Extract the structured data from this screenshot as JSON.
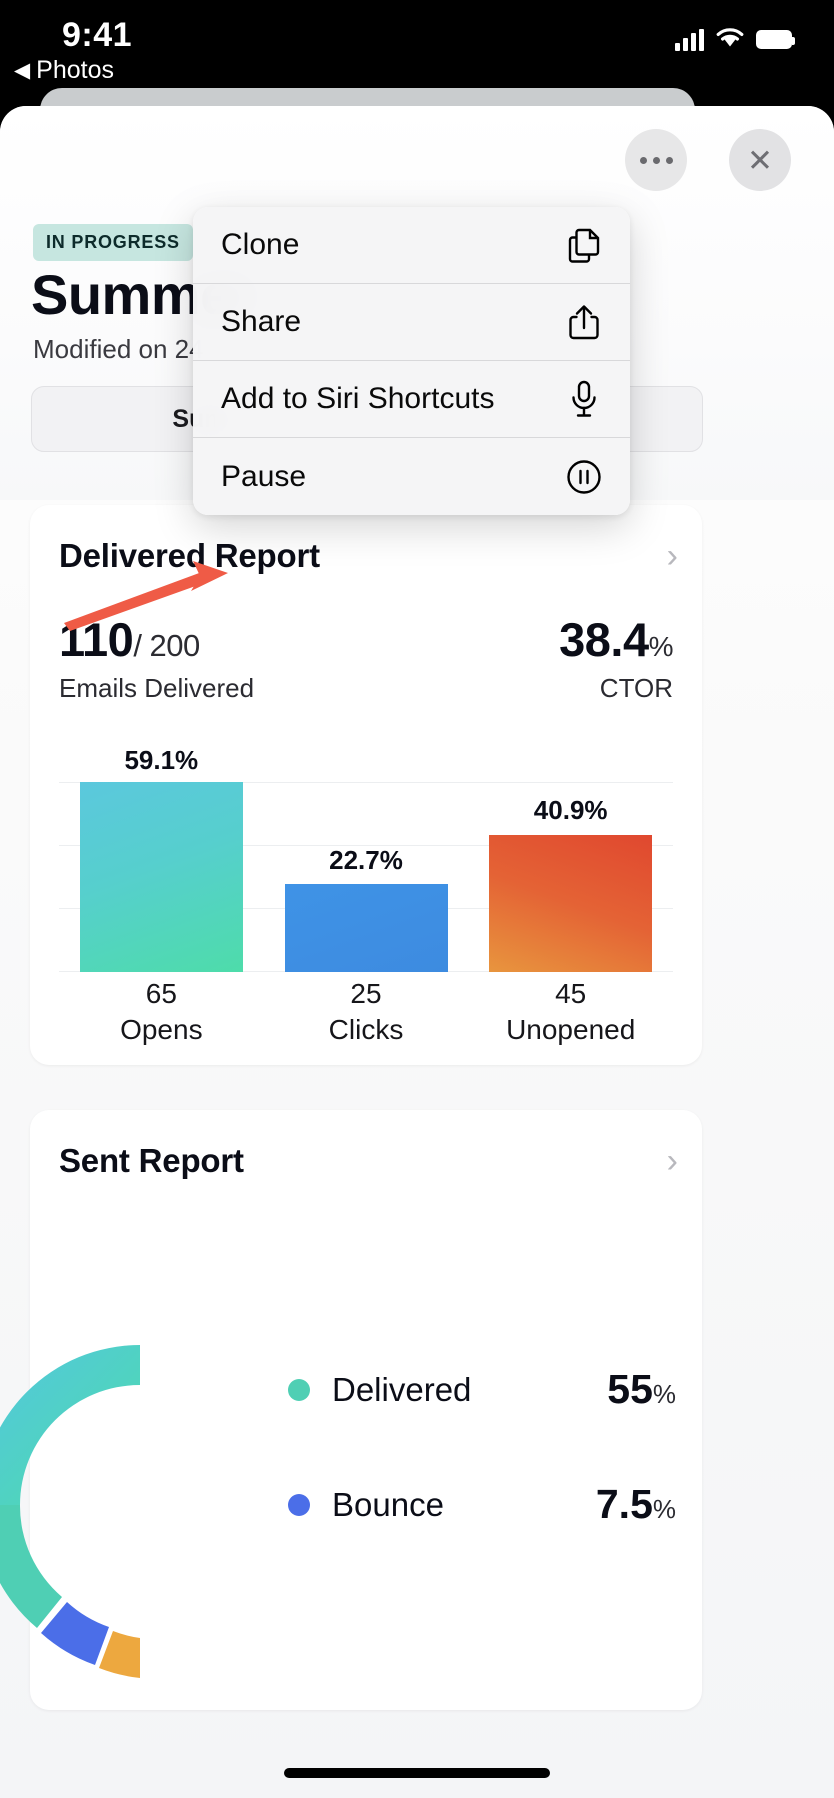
{
  "status_bar": {
    "time": "9:41",
    "back_label": "Photos",
    "back_arrow": "◀",
    "icons": [
      "cellular-signal-icon",
      "wifi-icon",
      "battery-icon"
    ]
  },
  "sheet": {
    "status_badge": "IN PROGRESS",
    "title": "Summer",
    "modified": "Modified on 24",
    "segment_label": "Sum",
    "more_button": "more-options-button",
    "close_button": "✕"
  },
  "context_menu": {
    "items": [
      {
        "label": "Clone",
        "icon": "copy-icon"
      },
      {
        "label": "Share",
        "icon": "share-icon"
      },
      {
        "label": "Add to Siri Shortcuts",
        "icon": "microphone-icon"
      },
      {
        "label": "Pause",
        "icon": "pause-circle-icon"
      }
    ]
  },
  "delivered_card": {
    "title": "Delivered Report",
    "chevron": "›",
    "delivered_count": "110",
    "delivered_total": "/ 200",
    "delivered_label": "Emails Delivered",
    "ctor_value": "38.4",
    "ctor_unit": "%",
    "ctor_label": "CTOR"
  },
  "sent_card": {
    "title": "Sent Report",
    "chevron": "›",
    "legend": [
      {
        "name": "Delivered",
        "value": "55",
        "unit": "%",
        "color": "#4fcfb4"
      },
      {
        "name": "Bounce",
        "value": "7.5",
        "unit": "%",
        "color": "#4b6ee8"
      }
    ]
  },
  "colors": {
    "badge_bg": "#c6e6e0",
    "bar_opens_start": "#5bc8dd",
    "bar_opens_end": "#4edcaa",
    "bar_clicks": "#3d90e3",
    "bar_unopened_start": "#e8903c",
    "bar_unopened_end": "#e0482f",
    "donut_delivered": "#4fcfb4",
    "donut_bounce": "#4b6ee8",
    "donut_other": "#eda83f",
    "arrow": "#ef5b46"
  },
  "chart_data": [
    {
      "type": "bar",
      "title": "Delivered Report",
      "categories": [
        "Opens",
        "Clicks",
        "Unopened"
      ],
      "values": [
        59.1,
        22.7,
        40.9
      ],
      "value_labels": [
        "59.1%",
        "22.7%",
        "40.9%"
      ],
      "counts": [
        65,
        25,
        45
      ],
      "count_labels": [
        "65",
        "25",
        "45"
      ],
      "ylim": [
        0,
        70
      ],
      "grid": true,
      "xlabel": "",
      "ylabel": "",
      "legend": "none",
      "series_colors": [
        "#5bc8dd",
        "#3d90e3",
        "#e8903c"
      ]
    },
    {
      "type": "pie",
      "title": "Sent Report",
      "subtype": "donut",
      "labels": [
        "Delivered",
        "Bounce"
      ],
      "values": [
        55,
        7.5
      ],
      "value_labels": [
        "55%",
        "7.5%"
      ],
      "colors": [
        "#4fcfb4",
        "#4b6ee8"
      ],
      "legend": "right"
    }
  ]
}
